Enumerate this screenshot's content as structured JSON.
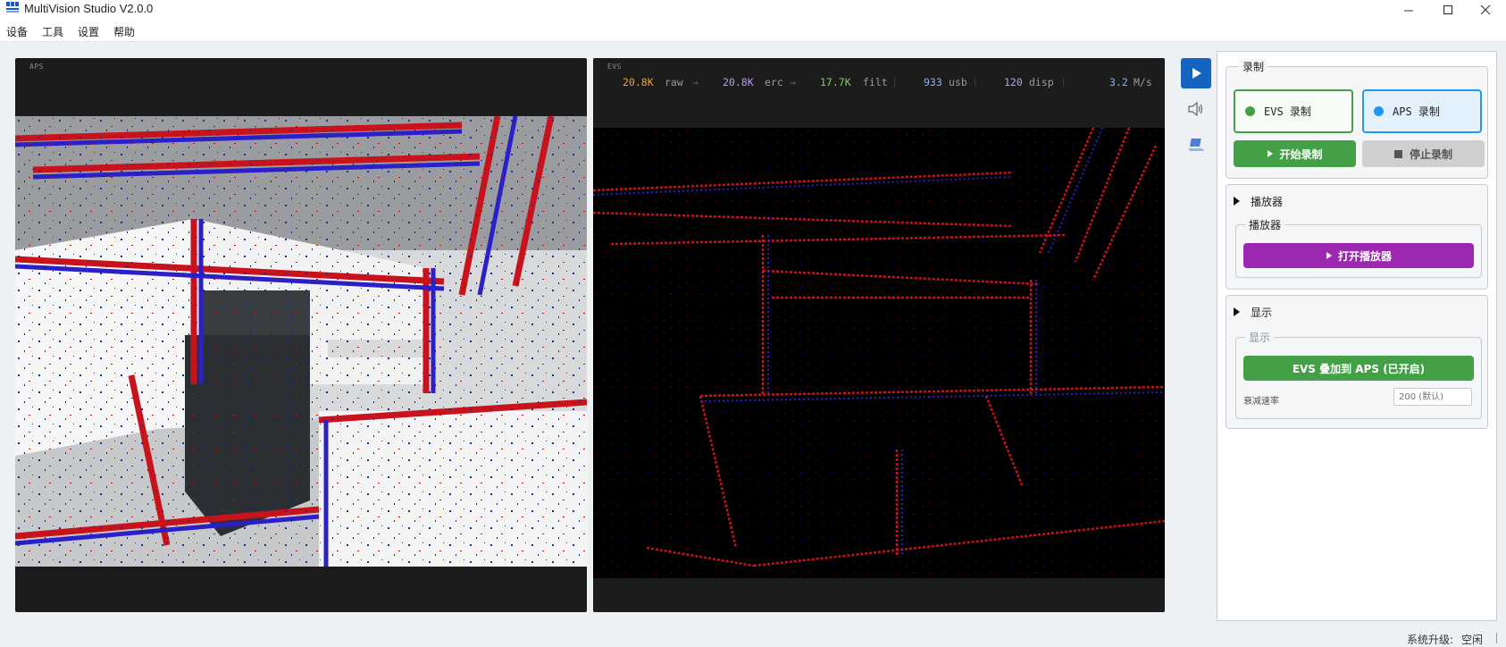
{
  "window": {
    "title": "MultiVision Studio V2.0.0",
    "controls": [
      "minimize-icon",
      "maximize-icon",
      "close-icon"
    ]
  },
  "menu": [
    "设备",
    "工具",
    "设置",
    "帮助"
  ],
  "aps_view": {
    "label": "APS"
  },
  "evs_view": {
    "label": "EVS",
    "stats": {
      "raw_value": "20.8K",
      "raw_label": "raw",
      "erc_value": "20.8K",
      "erc_label": "erc",
      "filt_value": "17.7K",
      "filt_label": "filt",
      "usb_value": "933",
      "usb_label": "usb",
      "disp_value": "120",
      "disp_label": "disp",
      "rate_value": "3.2",
      "rate_unit": "M/s",
      "arrow": "→"
    }
  },
  "toolstrip": [
    "play-icon",
    "speaker-icon",
    "laptop-icon"
  ],
  "recording": {
    "title": "录制",
    "evs_toggle": "EVS 录制",
    "aps_toggle": "APS 录制",
    "start": "开始录制",
    "stop": "停止录制"
  },
  "player": {
    "section": "播放器",
    "group": "播放器",
    "open": "打开播放器"
  },
  "display": {
    "section": "显示",
    "group": "显示",
    "overlay": "EVS 叠加到 APS (已开启)",
    "decay_label": "衰减速率",
    "decay_placeholder": "200 (默认)"
  },
  "status": {
    "upgrade_label": "系统升级:",
    "upgrade_value": "空闲"
  },
  "colors": {
    "accent_blue": "#1565c0",
    "green": "#43a047",
    "purple": "#9c27b0",
    "event_red": "#c8121c",
    "event_blue": "#2a1fc8",
    "stat_orange": "#f0a030",
    "stat_purple": "#b99cf0",
    "stat_green": "#7cd05a",
    "stat_blue": "#8aaef5"
  }
}
